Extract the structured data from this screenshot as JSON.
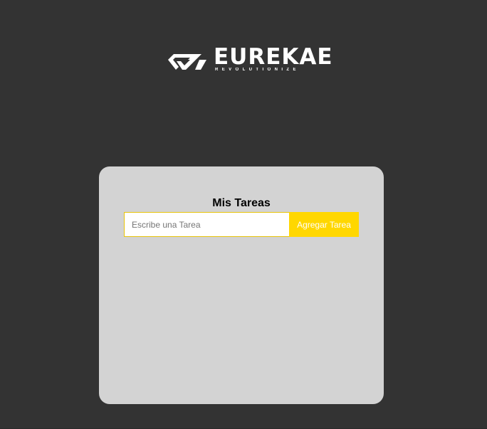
{
  "brand": {
    "name": "EUREKAE",
    "tagline": "REVOLUTIONIZE",
    "logo_icon": "eurekae-logo-icon"
  },
  "todo": {
    "title": "Mis Tareas",
    "input": {
      "value": "",
      "placeholder": "Escribe una Tarea"
    },
    "add_button_label": "Agregar Tarea",
    "tasks": []
  },
  "colors": {
    "background": "#333333",
    "card": "#d3d3d3",
    "accent": "#ffd700",
    "input_border": "#e8c40a"
  }
}
